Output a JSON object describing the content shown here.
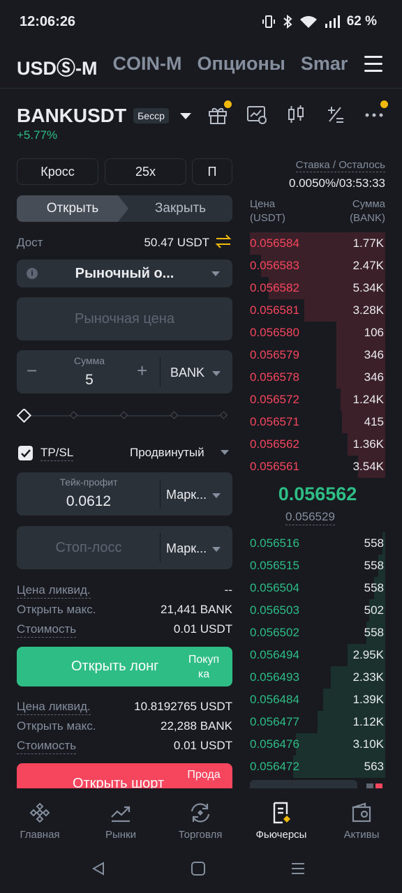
{
  "status": {
    "time": "12:06:26",
    "battery": "62 %"
  },
  "top_tabs": [
    "USDⓈ-M",
    "COIN-M",
    "Опционы",
    "Smar"
  ],
  "pair": {
    "symbol": "BANKUSDT",
    "badge": "Бесср",
    "change": "+5.77%"
  },
  "funding": {
    "label": "Ставка / Осталось",
    "value": "0.0050%/03:53:33"
  },
  "controls": {
    "margin_mode": "Кросс",
    "leverage": "25x",
    "mode": "П"
  },
  "tabs": {
    "open": "Открыть",
    "close": "Закрыть"
  },
  "available": {
    "label": "Дост",
    "value": "50.47 USDT"
  },
  "order_type": {
    "label": "Рыночный о..."
  },
  "market_price_placeholder": "Рыночная цена",
  "amount": {
    "label": "Сумма",
    "value": "5",
    "unit": "BANK",
    "minus": "−",
    "plus": "+"
  },
  "slider": {
    "fraction": 0
  },
  "tpsl": {
    "checked": true,
    "label": "TP/SL",
    "advanced": "Продвинутый"
  },
  "take_profit": {
    "label": "Тейк-профит",
    "value": "0.0612",
    "type": "Марк..."
  },
  "stop_loss": {
    "placeholder": "Стоп-лосс",
    "type": "Марк..."
  },
  "long_info": {
    "liq_label": "Цена ликвид.",
    "liq_value": "--",
    "max_label": "Открыть макс.",
    "max_value": "21,441 BANK",
    "cost_label": "Стоимость",
    "cost_value": "0.01 USDT"
  },
  "long_button": {
    "label": "Открыть лонг",
    "side": "Покуп ка"
  },
  "short_info": {
    "liq_label": "Цена ликвид.",
    "liq_value": "10.8192765 USDT",
    "max_label": "Открыть макс.",
    "max_value": "22,288 BANK",
    "cost_label": "Стоимость",
    "cost_value": "0.01 USDT"
  },
  "short_button": {
    "label": "Открыть шорт",
    "side": "Прода"
  },
  "orderbook": {
    "price_header": "Цена (USDT)",
    "size_header": "Сумма (BANK)",
    "asks": [
      {
        "price": "0.056584",
        "qty": "1.77K",
        "depth": 1.0
      },
      {
        "price": "0.056583",
        "qty": "2.47K",
        "depth": 0.92
      },
      {
        "price": "0.056582",
        "qty": "5.34K",
        "depth": 0.86
      },
      {
        "price": "0.056581",
        "qty": "3.28K",
        "depth": 0.6
      },
      {
        "price": "0.056580",
        "qty": "106",
        "depth": 0.36
      },
      {
        "price": "0.056579",
        "qty": "346",
        "depth": 0.36
      },
      {
        "price": "0.056578",
        "qty": "346",
        "depth": 0.36
      },
      {
        "price": "0.056572",
        "qty": "1.24K",
        "depth": 0.33
      },
      {
        "price": "0.056571",
        "qty": "415",
        "depth": 0.32
      },
      {
        "price": "0.056562",
        "qty": "1.36K",
        "depth": 0.28
      },
      {
        "price": "0.056561",
        "qty": "3.54K",
        "depth": 0.2
      }
    ],
    "last_price": "0.056562",
    "mark_price": "0.056529",
    "bids": [
      {
        "price": "0.056516",
        "qty": "558",
        "depth": 0.02
      },
      {
        "price": "0.056515",
        "qty": "558",
        "depth": 0.05
      },
      {
        "price": "0.056504",
        "qty": "558",
        "depth": 0.08
      },
      {
        "price": "0.056503",
        "qty": "502",
        "depth": 0.12
      },
      {
        "price": "0.056502",
        "qty": "558",
        "depth": 0.14
      },
      {
        "price": "0.056494",
        "qty": "2.95K",
        "depth": 0.28
      },
      {
        "price": "0.056493",
        "qty": "2.33K",
        "depth": 0.4
      },
      {
        "price": "0.056484",
        "qty": "1.39K",
        "depth": 0.46
      },
      {
        "price": "0.056477",
        "qty": "1.12K",
        "depth": 0.5
      },
      {
        "price": "0.056476",
        "qty": "3.10K",
        "depth": 0.66
      },
      {
        "price": "0.056472",
        "qty": "563",
        "depth": 0.68
      }
    ]
  },
  "bottom_nav": [
    {
      "label": "Главная",
      "icon": "home-icon"
    },
    {
      "label": "Рынки",
      "icon": "markets-icon"
    },
    {
      "label": "Торговля",
      "icon": "trade-icon"
    },
    {
      "label": "Фьючерсы",
      "icon": "futures-icon",
      "active": true
    },
    {
      "label": "Активы",
      "icon": "wallet-icon"
    }
  ],
  "colors": {
    "buy": "#2ebd85",
    "sell": "#f6465d",
    "accent": "#f0b90b"
  }
}
